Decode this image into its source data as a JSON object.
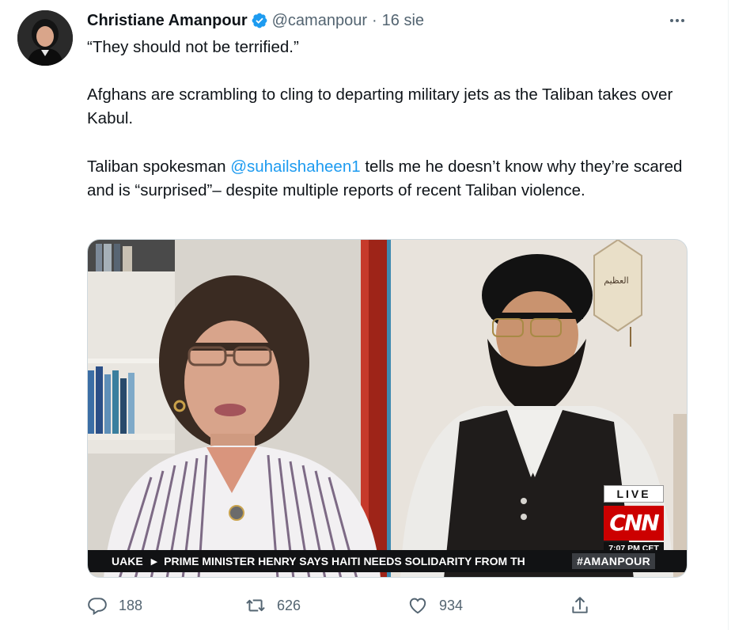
{
  "tweet": {
    "author_name": "Christiane Amanpour",
    "handle": "@camanpour",
    "separator": "·",
    "date": "16 sie",
    "paragraphs": {
      "p1": "“They should not be terrified.”",
      "p2": "Afghans are scrambling to cling to departing military jets as the Taliban takes over Kabul.",
      "p3_before": "Taliban spokesman ",
      "p3_mention": "@suhailshaheen1",
      "p3_after": " tells me he doesn’t know why they’re scared and is “surprised”– despite multiple reports of recent Taliban violence."
    }
  },
  "media": {
    "ticker_text": "UAKE",
    "ticker_headline": "PRIME MINISTER HENRY SAYS HAITI NEEDS SOLIDARITY FROM TH",
    "hashtag": "#AMANPOUR",
    "live_label": "LIVE",
    "network_logo_text": "CNN",
    "timestamp": "7:07 PM CET"
  },
  "actions": {
    "replies": "188",
    "retweets": "626",
    "likes": "934"
  },
  "icons": {
    "verified": "verified-badge-icon",
    "more": "more-icon",
    "reply": "reply-icon",
    "retweet": "retweet-icon",
    "like": "like-icon",
    "share": "share-icon"
  },
  "colors": {
    "accent": "#1d9bf0",
    "secondary_text": "#536471",
    "cnn_red": "#cc0000"
  }
}
